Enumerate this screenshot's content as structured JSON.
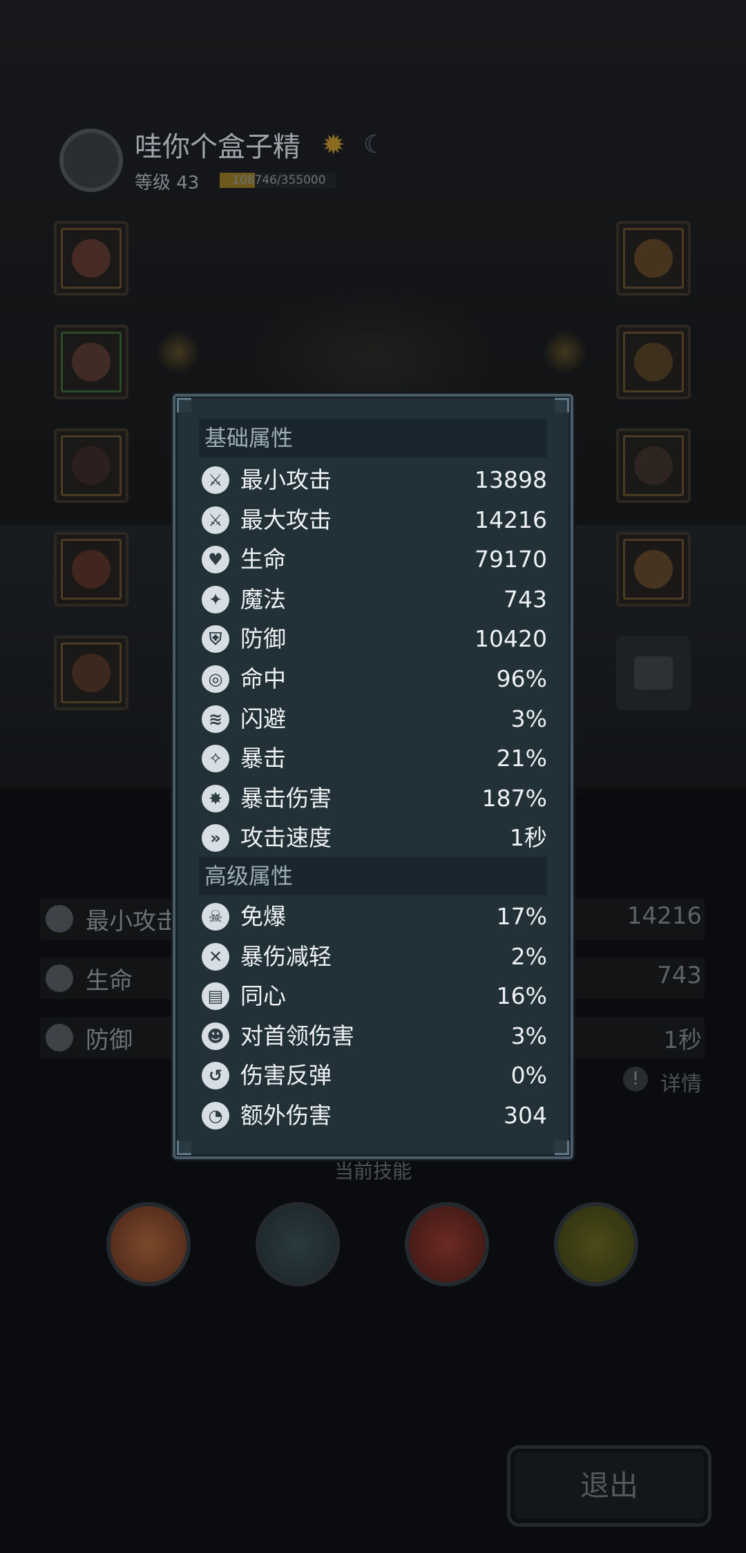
{
  "player": {
    "name": "哇你个盒子精",
    "level_label": "等级 43",
    "xp_text": "108746/355000",
    "xp_fraction": 0.306
  },
  "colors": {
    "panel_bg": "#223038",
    "panel_border": "#4a5c68",
    "section_bg": "#1a262d",
    "text": "#eef2f4",
    "icon_bg": "#d8dfe4"
  },
  "popup": {
    "basic": {
      "title": "基础属性",
      "rows": [
        {
          "icon": "sword-icon",
          "glyph": "⚔",
          "label": "最小攻击",
          "value": "13898"
        },
        {
          "icon": "sword-icon",
          "glyph": "⚔",
          "label": "最大攻击",
          "value": "14216"
        },
        {
          "icon": "heart-icon",
          "glyph": "♥",
          "label": "生命",
          "value": "79170"
        },
        {
          "icon": "magic-icon",
          "glyph": "✦",
          "label": "魔法",
          "value": "743"
        },
        {
          "icon": "shield-icon",
          "glyph": "⛨",
          "label": "防御",
          "value": "10420"
        },
        {
          "icon": "target-icon",
          "glyph": "◎",
          "label": "命中",
          "value": "96%"
        },
        {
          "icon": "dodge-icon",
          "glyph": "≋",
          "label": "闪避",
          "value": "3%"
        },
        {
          "icon": "crit-icon",
          "glyph": "✧",
          "label": "暴击",
          "value": "21%"
        },
        {
          "icon": "crit-damage-icon",
          "glyph": "✸",
          "label": "暴击伤害",
          "value": "187%"
        },
        {
          "icon": "attack-speed-icon",
          "glyph": "»",
          "label": "攻击速度",
          "value": "1秒"
        }
      ]
    },
    "advanced": {
      "title": "高级属性",
      "rows": [
        {
          "icon": "skull-icon",
          "glyph": "☠",
          "label": "免爆",
          "value": "17%"
        },
        {
          "icon": "crit-reduce-icon",
          "glyph": "✕",
          "label": "暴伤减轻",
          "value": "2%"
        },
        {
          "icon": "scroll-icon",
          "glyph": "▤",
          "label": "同心",
          "value": "16%"
        },
        {
          "icon": "boss-icon",
          "glyph": "☻",
          "label": "对首领伤害",
          "value": "3%"
        },
        {
          "icon": "reflect-icon",
          "glyph": "↺",
          "label": "伤害反弹",
          "value": "0%"
        },
        {
          "icon": "extra-damage-icon",
          "glyph": "◔",
          "label": "额外伤害",
          "value": "304"
        }
      ]
    }
  },
  "background_stats": [
    {
      "icon": "sword-icon",
      "label": "最小攻击",
      "value": "14216"
    },
    {
      "icon": "heart-icon",
      "label": "生命",
      "value": "743"
    },
    {
      "icon": "shield-icon",
      "label": "防御",
      "value": "1秒"
    }
  ],
  "detail_label": "详情",
  "skills_title": "当前技能",
  "exit_label": "退出"
}
